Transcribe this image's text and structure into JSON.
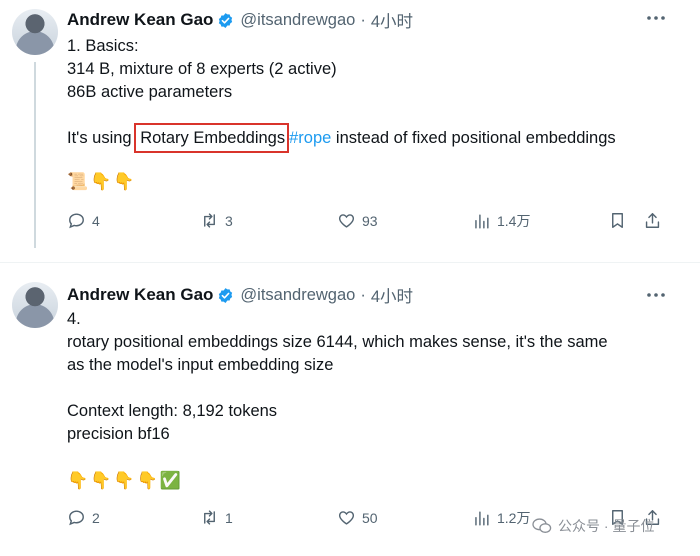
{
  "tweets": [
    {
      "author": "Andrew Kean Gao",
      "handle": "@itsandrewgao",
      "separator": "·",
      "time": "4小时",
      "lines": [
        "1. Basics:",
        "314 B, mixture of 8 experts (2 active)",
        "86B active parameters"
      ],
      "highlight_line": {
        "before": "It's using ",
        "boxed": "Rotary Embeddings",
        "hashtag": "#rope",
        "after": " instead of fixed positional embeddings"
      },
      "emojis": "📜👇👇",
      "actions": {
        "replies": "4",
        "reposts": "3",
        "likes": "93",
        "views": "1.4万"
      }
    },
    {
      "author": "Andrew Kean Gao",
      "handle": "@itsandrewgao",
      "separator": "·",
      "time": "4小时",
      "lines": [
        "4.",
        "rotary positional embeddings size 6144, which makes sense, it's the same",
        "as the model's input embedding size",
        "",
        "Context length: 8,192 tokens",
        "precision bf16"
      ],
      "emojis": "👇👇👇👇✅",
      "actions": {
        "replies": "2",
        "reposts": "1",
        "likes": "50",
        "views": "1.2万"
      }
    }
  ],
  "watermark": "公众号 · 量子位",
  "colors": {
    "accent": "#1d9bf0",
    "highlight_box": "#d9342b",
    "muted": "#536471"
  },
  "icons": [
    "verified-badge-icon",
    "more-icon",
    "reply-icon",
    "repost-icon",
    "like-icon",
    "views-icon",
    "bookmark-icon",
    "share-icon",
    "wechat-icon"
  ]
}
